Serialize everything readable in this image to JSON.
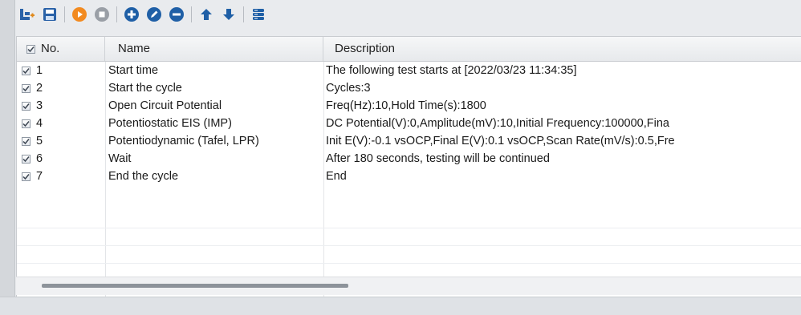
{
  "toolbar": {
    "buttons": [
      {
        "name": "tree-add-icon",
        "color": "#2a62a8"
      },
      {
        "name": "save-icon",
        "color": "#2a62a8"
      },
      {
        "name": "start-icon",
        "color": "#f28a20"
      },
      {
        "name": "stop-icon",
        "color": "#9a9fa6"
      },
      {
        "name": "add-step-icon",
        "color": "#1f5fa6"
      },
      {
        "name": "edit-step-icon",
        "color": "#1f5fa6"
      },
      {
        "name": "remove-step-icon",
        "color": "#1f5fa6"
      },
      {
        "name": "move-up-icon",
        "color": "#1f5fa6"
      },
      {
        "name": "move-down-icon",
        "color": "#1f5fa6"
      },
      {
        "name": "database-icon",
        "color": "#1f5fa6"
      }
    ]
  },
  "table": {
    "columns": {
      "no": "No.",
      "name": "Name",
      "description": "Description"
    },
    "rows": [
      {
        "no": "1",
        "checked": true,
        "name": "Start time",
        "description": "The following test starts at [2022/03/23 11:34:35]"
      },
      {
        "no": "2",
        "checked": true,
        "name": "Start the cycle",
        "description": "Cycles:3"
      },
      {
        "no": "3",
        "checked": true,
        "name": "Open Circuit Potential",
        "description": "Freq(Hz):10,Hold Time(s):1800"
      },
      {
        "no": "4",
        "checked": true,
        "name": "Potentiostatic EIS (IMP)",
        "description": "DC Potential(V):0,Amplitude(mV):10,Initial Frequency:100000,Fina"
      },
      {
        "no": "5",
        "checked": true,
        "name": "Potentiodynamic (Tafel, LPR)",
        "description": "Init E(V):-0.1 vsOCP,Final E(V):0.1 vsOCP,Scan Rate(mV/s):0.5,Fre"
      },
      {
        "no": "6",
        "checked": true,
        "name": "Wait",
        "description": "After 180 seconds, testing will be continued"
      },
      {
        "no": "7",
        "checked": true,
        "name": "End the cycle",
        "description": "End"
      }
    ]
  }
}
